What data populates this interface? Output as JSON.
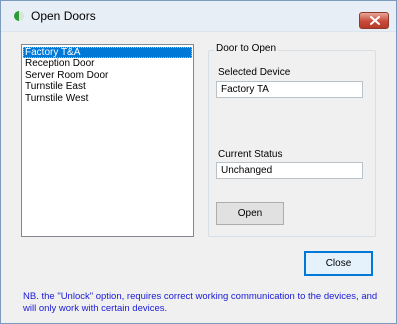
{
  "window": {
    "title": "Open Doors"
  },
  "devices": {
    "items": [
      "Factory T&A",
      "Reception Door",
      "Server Room Door",
      "Turnstile East",
      "Turnstile West"
    ],
    "selected_index": 0
  },
  "door_group": {
    "legend": "Door to Open",
    "selected_device_label": "Selected Device",
    "selected_device_value": "Factory TA",
    "current_status_label": "Current Status",
    "current_status_value": "Unchanged",
    "open_button": "Open"
  },
  "footer": {
    "close_button": "Close",
    "note": "NB. the \"Unlock\" option, requires correct working communication to the devices, and will only work with certain devices."
  },
  "colors": {
    "selection": "#0078d7",
    "note_text": "#1a1ad6",
    "close_button_red": "#c94a38"
  },
  "icons": {
    "app": "green-half-circle-icon",
    "close": "close-icon"
  }
}
